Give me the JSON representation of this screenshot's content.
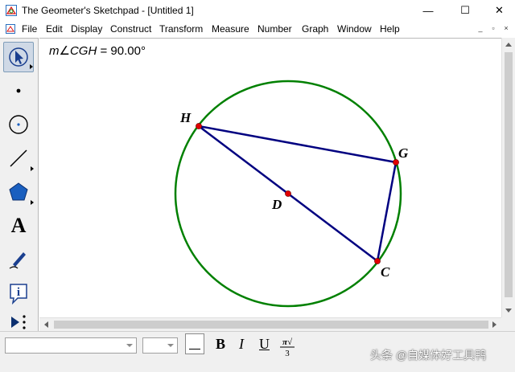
{
  "window": {
    "title": "The Geometer's Sketchpad - [Untitled 1]",
    "minimize_glyph": "—",
    "maximize_glyph": "☐",
    "close_glyph": "✕"
  },
  "menu": {
    "items": [
      "File",
      "Edit",
      "Display",
      "Construct",
      "Transform",
      "Measure",
      "Number",
      "Graph",
      "Window",
      "Help"
    ],
    "mdi_minimize": "_",
    "mdi_restore": "▫",
    "mdi_close": "×"
  },
  "toolbox": {
    "tools": [
      "arrow-tool-icon",
      "point-tool-icon",
      "compass-tool-icon",
      "straightedge-tool-icon",
      "polygon-tool-icon",
      "text-tool-icon",
      "marker-tool-icon",
      "information-tool-icon",
      "custom-tool-icon"
    ],
    "text_tool_glyph": "A",
    "info_tool_glyph": "i"
  },
  "sketch": {
    "measurement": {
      "prefix": "m∠",
      "angle_name": "CGH",
      "equals": " = ",
      "value": "90.00°"
    },
    "labels": {
      "H": "H",
      "G": "G",
      "D": "D",
      "C": "C"
    },
    "circle_color": "#008000",
    "segment_color": "#000080",
    "point_color": "#e00000"
  },
  "textbar": {
    "bold": "B",
    "italic": "I",
    "underline": "U",
    "math_top": "π√",
    "math_bottom": "3"
  },
  "watermark": "头条 @自媒体好工具鸭"
}
